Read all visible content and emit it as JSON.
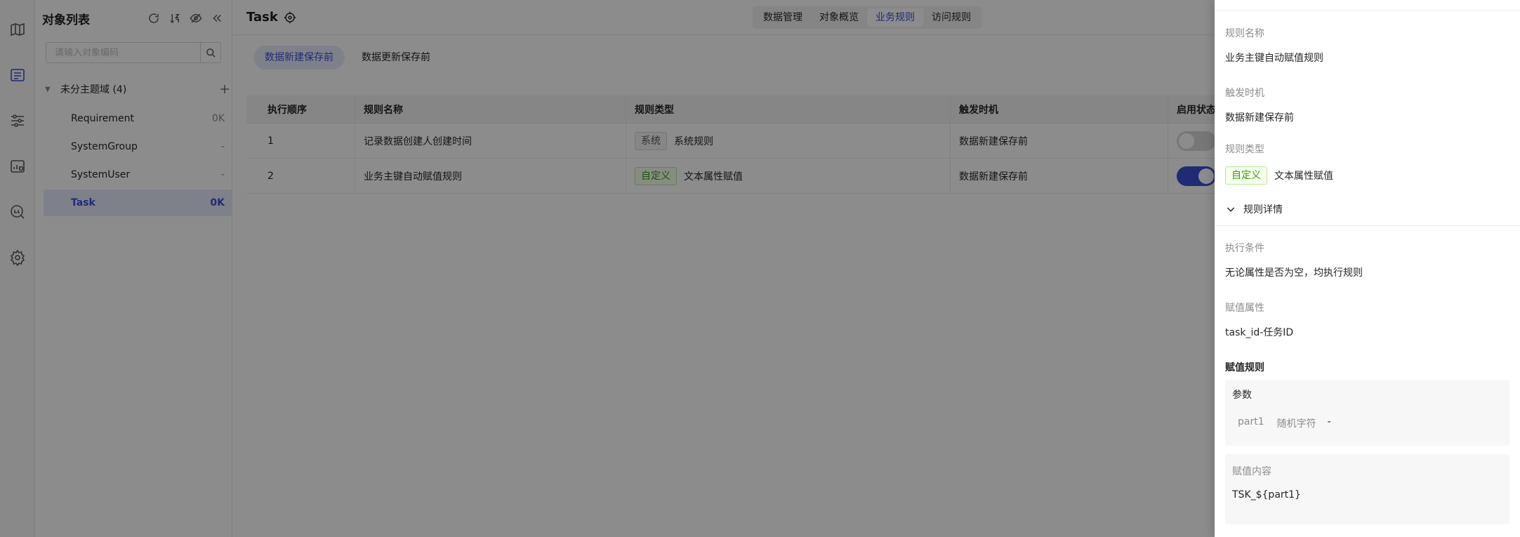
{
  "sidebar": {
    "title": "对象列表",
    "search_placeholder": "请输入对象编码",
    "group_label": "未分主题域 (4)",
    "items": [
      {
        "label": "Requirement",
        "count": "0K"
      },
      {
        "label": "SystemGroup",
        "count": "-"
      },
      {
        "label": "SystemUser",
        "count": "-"
      },
      {
        "label": "Task",
        "count": "0K"
      }
    ]
  },
  "header": {
    "title": "Task",
    "tabs": [
      "数据管理",
      "对象概览",
      "业务规则",
      "访问规则"
    ],
    "active_tab": "业务规则"
  },
  "subtabs": [
    "数据新建保存前",
    "数据更新保存前"
  ],
  "table": {
    "headers": [
      "执行顺序",
      "规则名称",
      "规则类型",
      "触发时机",
      "启用状态"
    ],
    "rows": [
      {
        "order": "1",
        "name": "记录数据创建人创建时间",
        "tag": "系统",
        "type": "系统规则",
        "trigger": "数据新建保存前",
        "enabled": false
      },
      {
        "order": "2",
        "name": "业务主键自动赋值规则",
        "tag": "自定义",
        "type": "文本属性赋值",
        "trigger": "数据新建保存前",
        "enabled": true
      }
    ]
  },
  "drawer": {
    "name_label": "规则名称",
    "name_value": "业务主键自动赋值规则",
    "trigger_label": "触发时机",
    "trigger_value": "数据新建保存前",
    "type_label": "规则类型",
    "type_tag": "自定义",
    "type_value": "文本属性赋值",
    "section_title": "规则详情",
    "cond_label": "执行条件",
    "cond_value": "无论属性是否为空，均执行规则",
    "attr_label": "赋值属性",
    "attr_value": "task_id-任务ID",
    "rule_label": "赋值规则",
    "params_label": "参数",
    "param": {
      "name": "part1",
      "kind": "随机字符",
      "value": "-"
    },
    "content_label": "赋值内容",
    "content_value": "TSK_${part1}"
  },
  "colors": {
    "accent": "#3b4fd8",
    "custom_tag": "#389e0d",
    "mask": "rgba(0,0,0,0.45)"
  }
}
